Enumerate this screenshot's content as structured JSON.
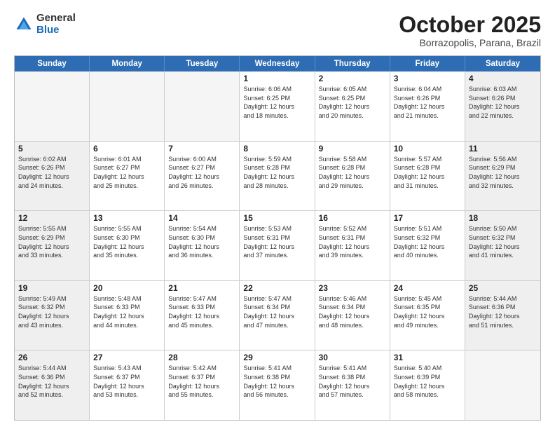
{
  "logo": {
    "general": "General",
    "blue": "Blue"
  },
  "title": "October 2025",
  "subtitle": "Borrazopolis, Parana, Brazil",
  "weekdays": [
    "Sunday",
    "Monday",
    "Tuesday",
    "Wednesday",
    "Thursday",
    "Friday",
    "Saturday"
  ],
  "weeks": [
    [
      {
        "day": "",
        "info": "",
        "empty": true
      },
      {
        "day": "",
        "info": "",
        "empty": true
      },
      {
        "day": "",
        "info": "",
        "empty": true
      },
      {
        "day": "1",
        "info": "Sunrise: 6:06 AM\nSunset: 6:25 PM\nDaylight: 12 hours\nand 18 minutes."
      },
      {
        "day": "2",
        "info": "Sunrise: 6:05 AM\nSunset: 6:25 PM\nDaylight: 12 hours\nand 20 minutes."
      },
      {
        "day": "3",
        "info": "Sunrise: 6:04 AM\nSunset: 6:26 PM\nDaylight: 12 hours\nand 21 minutes."
      },
      {
        "day": "4",
        "info": "Sunrise: 6:03 AM\nSunset: 6:26 PM\nDaylight: 12 hours\nand 22 minutes.",
        "shaded": true
      }
    ],
    [
      {
        "day": "5",
        "info": "Sunrise: 6:02 AM\nSunset: 6:26 PM\nDaylight: 12 hours\nand 24 minutes.",
        "shaded": true
      },
      {
        "day": "6",
        "info": "Sunrise: 6:01 AM\nSunset: 6:27 PM\nDaylight: 12 hours\nand 25 minutes."
      },
      {
        "day": "7",
        "info": "Sunrise: 6:00 AM\nSunset: 6:27 PM\nDaylight: 12 hours\nand 26 minutes."
      },
      {
        "day": "8",
        "info": "Sunrise: 5:59 AM\nSunset: 6:28 PM\nDaylight: 12 hours\nand 28 minutes."
      },
      {
        "day": "9",
        "info": "Sunrise: 5:58 AM\nSunset: 6:28 PM\nDaylight: 12 hours\nand 29 minutes."
      },
      {
        "day": "10",
        "info": "Sunrise: 5:57 AM\nSunset: 6:28 PM\nDaylight: 12 hours\nand 31 minutes."
      },
      {
        "day": "11",
        "info": "Sunrise: 5:56 AM\nSunset: 6:29 PM\nDaylight: 12 hours\nand 32 minutes.",
        "shaded": true
      }
    ],
    [
      {
        "day": "12",
        "info": "Sunrise: 5:55 AM\nSunset: 6:29 PM\nDaylight: 12 hours\nand 33 minutes.",
        "shaded": true
      },
      {
        "day": "13",
        "info": "Sunrise: 5:55 AM\nSunset: 6:30 PM\nDaylight: 12 hours\nand 35 minutes."
      },
      {
        "day": "14",
        "info": "Sunrise: 5:54 AM\nSunset: 6:30 PM\nDaylight: 12 hours\nand 36 minutes."
      },
      {
        "day": "15",
        "info": "Sunrise: 5:53 AM\nSunset: 6:31 PM\nDaylight: 12 hours\nand 37 minutes."
      },
      {
        "day": "16",
        "info": "Sunrise: 5:52 AM\nSunset: 6:31 PM\nDaylight: 12 hours\nand 39 minutes."
      },
      {
        "day": "17",
        "info": "Sunrise: 5:51 AM\nSunset: 6:32 PM\nDaylight: 12 hours\nand 40 minutes."
      },
      {
        "day": "18",
        "info": "Sunrise: 5:50 AM\nSunset: 6:32 PM\nDaylight: 12 hours\nand 41 minutes.",
        "shaded": true
      }
    ],
    [
      {
        "day": "19",
        "info": "Sunrise: 5:49 AM\nSunset: 6:32 PM\nDaylight: 12 hours\nand 43 minutes.",
        "shaded": true
      },
      {
        "day": "20",
        "info": "Sunrise: 5:48 AM\nSunset: 6:33 PM\nDaylight: 12 hours\nand 44 minutes."
      },
      {
        "day": "21",
        "info": "Sunrise: 5:47 AM\nSunset: 6:33 PM\nDaylight: 12 hours\nand 45 minutes."
      },
      {
        "day": "22",
        "info": "Sunrise: 5:47 AM\nSunset: 6:34 PM\nDaylight: 12 hours\nand 47 minutes."
      },
      {
        "day": "23",
        "info": "Sunrise: 5:46 AM\nSunset: 6:34 PM\nDaylight: 12 hours\nand 48 minutes."
      },
      {
        "day": "24",
        "info": "Sunrise: 5:45 AM\nSunset: 6:35 PM\nDaylight: 12 hours\nand 49 minutes."
      },
      {
        "day": "25",
        "info": "Sunrise: 5:44 AM\nSunset: 6:36 PM\nDaylight: 12 hours\nand 51 minutes.",
        "shaded": true
      }
    ],
    [
      {
        "day": "26",
        "info": "Sunrise: 5:44 AM\nSunset: 6:36 PM\nDaylight: 12 hours\nand 52 minutes.",
        "shaded": true
      },
      {
        "day": "27",
        "info": "Sunrise: 5:43 AM\nSunset: 6:37 PM\nDaylight: 12 hours\nand 53 minutes."
      },
      {
        "day": "28",
        "info": "Sunrise: 5:42 AM\nSunset: 6:37 PM\nDaylight: 12 hours\nand 55 minutes."
      },
      {
        "day": "29",
        "info": "Sunrise: 5:41 AM\nSunset: 6:38 PM\nDaylight: 12 hours\nand 56 minutes."
      },
      {
        "day": "30",
        "info": "Sunrise: 5:41 AM\nSunset: 6:38 PM\nDaylight: 12 hours\nand 57 minutes."
      },
      {
        "day": "31",
        "info": "Sunrise: 5:40 AM\nSunset: 6:39 PM\nDaylight: 12 hours\nand 58 minutes."
      },
      {
        "day": "",
        "info": "",
        "empty": true
      }
    ]
  ]
}
